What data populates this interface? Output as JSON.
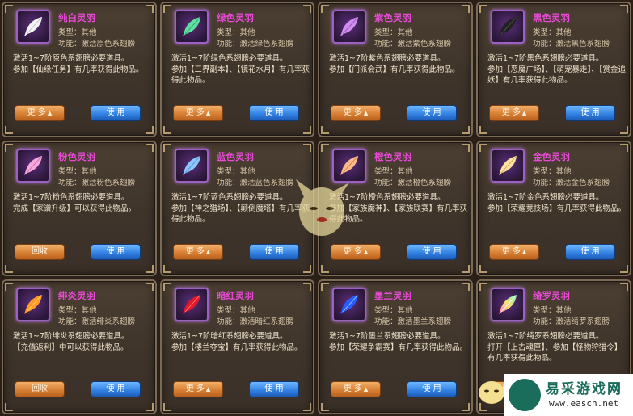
{
  "cards": [
    {
      "name": "纯白灵羽",
      "type": "类型：其他",
      "func": "功能：激活原色系翅膀",
      "desc1": "激活1~7阶原色系翅膀必要道具。",
      "desc2": "参加【仙缘任务】有几率获得此物品。",
      "btn_left": "更 多",
      "btn_right": "使 用",
      "color": "#f3f3f3"
    },
    {
      "name": "绿色灵羽",
      "type": "类型：其他",
      "func": "功能：激活绿色系翅膀",
      "desc1": "激活1~7阶绿色系翅膀必要道具。",
      "desc2": "参加【三界副本】、【镜花水月】有几率获得此物品。",
      "btn_left": "更 多",
      "btn_right": "使 用",
      "color": "#5fe0a0"
    },
    {
      "name": "紫色灵羽",
      "type": "类型：其他",
      "func": "功能：激活紫色系翅膀",
      "desc1": "激活1~7阶紫色系翅膀必要道具。",
      "desc2": "参加【门派会武】有几率获得此物品。",
      "btn_left": "更 多",
      "btn_right": "使 用",
      "color": "#d08ef0"
    },
    {
      "name": "黑色灵羽",
      "type": "类型：其他",
      "func": "功能：激活黑色系翅膀",
      "desc1": "激活1~7阶黑色系翅膀必要道具。",
      "desc2": "参加【恶魔广场】、【萌宠暴走】、【赏金追妖】有几率获得此物品。",
      "btn_left": "更 多",
      "btn_right": "使 用",
      "color": "#222222"
    },
    {
      "name": "粉色灵羽",
      "type": "类型：其他",
      "func": "功能：激活粉色系翅膀",
      "desc1": "激活1~7阶粉色系翅膀必要道具。",
      "desc2": "完成【家谱升级】可以获得此物品。",
      "btn_left": "回收",
      "btn_right": "使 用",
      "color": "#f6a8dc"
    },
    {
      "name": "蓝色灵羽",
      "type": "类型：其他",
      "func": "功能：激活蓝色系翅膀",
      "desc1": "激活1~7阶蓝色系翅膀必要道具。",
      "desc2": "参加【神之猎场】、【颠倒魔塔】有几率获得此物品。",
      "btn_left": "更 多",
      "btn_right": "使 用",
      "color": "#8cc8ff"
    },
    {
      "name": "橙色灵羽",
      "type": "类型：其他",
      "func": "功能：激活橙色系翅膀",
      "desc1": "激活1~7阶橙色系翅膀必要道具。",
      "desc2": "参加【家族魔神】、【家族联赛】有几率获得此物品。",
      "btn_left": "更 多",
      "btn_right": "使 用",
      "color": "#ffb888"
    },
    {
      "name": "金色灵羽",
      "type": "类型：其他",
      "func": "功能：激活金色系翅膀",
      "desc1": "激活1~7阶金色系翅膀必要道具。",
      "desc2": "参加【荣耀竞技场】有几率获得此物品。",
      "btn_left": "更 多",
      "btn_right": "使 用",
      "color": "#ffe2a0"
    },
    {
      "name": "绯炎灵羽",
      "type": "类型：其他",
      "func": "功能：激活绯炎系翅膀",
      "desc1": "激活1~7阶绯炎系翅膀必要道具。",
      "desc2": "【充值返利】中可以获得此物品。",
      "btn_left": "回收",
      "btn_right": "使 用",
      "color": "#ff9a2a"
    },
    {
      "name": "暗红灵羽",
      "type": "类型：其他",
      "func": "功能：激活暗红系翅膀",
      "desc1": "激活1~7阶暗红系翅膀必要道具。",
      "desc2": "参加【楼兰夺宝】有几率获得此物品。",
      "btn_left": "更 多",
      "btn_right": "使 用",
      "color": "#e01a2a"
    },
    {
      "name": "墨兰灵羽",
      "type": "类型：其他",
      "func": "功能：激活墨兰系翅膀",
      "desc1": "激活1~7阶墨兰系翅膀必要道具。",
      "desc2": "参加【荣耀争霸赛】有几率获得此物品。",
      "btn_left": "更 多",
      "btn_right": "使 用",
      "color": "#2a5cff"
    },
    {
      "name": "绮罗灵羽",
      "type": "类型：其他",
      "func": "功能：激活绮罗系翅膀",
      "desc1": "激活1~7阶绮罗系翅膀必要道具。",
      "desc2": "打开【上古魂匣】、参加【怪物狩猎令】有几率获得此物品。",
      "btn_left": "更 多",
      "btn_right": "使 用",
      "color": "#9ef0a8"
    }
  ],
  "watermark": {
    "title": "易采游戏网",
    "url": "www.eascn.net"
  }
}
